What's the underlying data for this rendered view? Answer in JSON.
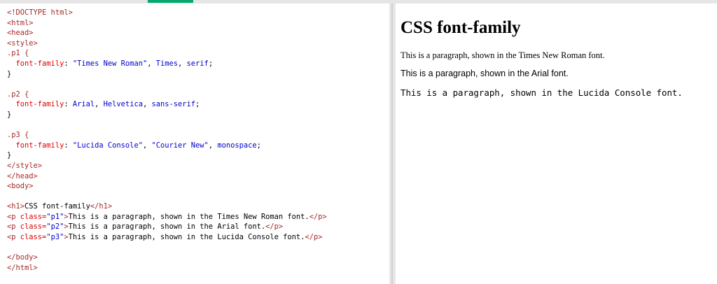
{
  "editor": {
    "lines": [
      [
        [
          "tag",
          "<!DOCTYPE html>"
        ]
      ],
      [
        [
          "tag",
          "<html>"
        ]
      ],
      [
        [
          "tag",
          "<head>"
        ]
      ],
      [
        [
          "tag",
          "<style>"
        ]
      ],
      [
        [
          "sel",
          ".p1 {"
        ]
      ],
      [
        [
          "txt",
          "  "
        ],
        [
          "prop",
          "font-family"
        ],
        [
          "txt",
          ": "
        ],
        [
          "val",
          "\"Times New Roman\""
        ],
        [
          "txt",
          ", "
        ],
        [
          "val",
          "Times"
        ],
        [
          "txt",
          ", "
        ],
        [
          "val",
          "serif"
        ],
        [
          "txt",
          ";"
        ]
      ],
      [
        [
          "txt",
          "}"
        ]
      ],
      [
        [
          "txt",
          ""
        ]
      ],
      [
        [
          "sel",
          ".p2 {"
        ]
      ],
      [
        [
          "txt",
          "  "
        ],
        [
          "prop",
          "font-family"
        ],
        [
          "txt",
          ": "
        ],
        [
          "val",
          "Arial"
        ],
        [
          "txt",
          ", "
        ],
        [
          "val",
          "Helvetica"
        ],
        [
          "txt",
          ", "
        ],
        [
          "val",
          "sans-serif"
        ],
        [
          "txt",
          ";"
        ]
      ],
      [
        [
          "txt",
          "}"
        ]
      ],
      [
        [
          "txt",
          ""
        ]
      ],
      [
        [
          "sel",
          ".p3 {"
        ]
      ],
      [
        [
          "txt",
          "  "
        ],
        [
          "prop",
          "font-family"
        ],
        [
          "txt",
          ": "
        ],
        [
          "val",
          "\"Lucida Console\""
        ],
        [
          "txt",
          ", "
        ],
        [
          "val",
          "\"Courier New\""
        ],
        [
          "txt",
          ", "
        ],
        [
          "val",
          "monospace"
        ],
        [
          "txt",
          ";"
        ]
      ],
      [
        [
          "txt",
          "}"
        ]
      ],
      [
        [
          "tag",
          "</style>"
        ]
      ],
      [
        [
          "tag",
          "</head>"
        ]
      ],
      [
        [
          "tag",
          "<body>"
        ]
      ],
      [
        [
          "txt",
          ""
        ]
      ],
      [
        [
          "tag",
          "<h1>"
        ],
        [
          "txt",
          "CSS font-family"
        ],
        [
          "tag",
          "</h1>"
        ]
      ],
      [
        [
          "tag",
          "<p "
        ],
        [
          "attr",
          "class="
        ],
        [
          "attrv",
          "\"p1\""
        ],
        [
          "tag",
          ">"
        ],
        [
          "txt",
          "This is a paragraph, shown in the Times New Roman font."
        ],
        [
          "tag",
          "</p>"
        ]
      ],
      [
        [
          "tag",
          "<p "
        ],
        [
          "attr",
          "class="
        ],
        [
          "attrv",
          "\"p2\""
        ],
        [
          "tag",
          ">"
        ],
        [
          "txt",
          "This is a paragraph, shown in the Arial font."
        ],
        [
          "tag",
          "</p>"
        ]
      ],
      [
        [
          "tag",
          "<p "
        ],
        [
          "attr",
          "class="
        ],
        [
          "attrv",
          "\"p3\""
        ],
        [
          "tag",
          ">"
        ],
        [
          "txt",
          "This is a paragraph, shown in the Lucida Console font."
        ],
        [
          "tag",
          "</p>"
        ]
      ],
      [
        [
          "txt",
          ""
        ]
      ],
      [
        [
          "tag",
          "</body>"
        ]
      ],
      [
        [
          "tag",
          "</html>"
        ]
      ]
    ]
  },
  "result": {
    "heading": "CSS font-family",
    "p1": "This is a paragraph, shown in the Times New Roman font.",
    "p2": "This is a paragraph, shown in the Arial font.",
    "p3": "This is a paragraph, shown in the Lucida Console font."
  },
  "colors": {
    "accent": "#04aa6d",
    "tag": "#a52a2a",
    "property": "#dd0000",
    "value": "#0000cd"
  }
}
